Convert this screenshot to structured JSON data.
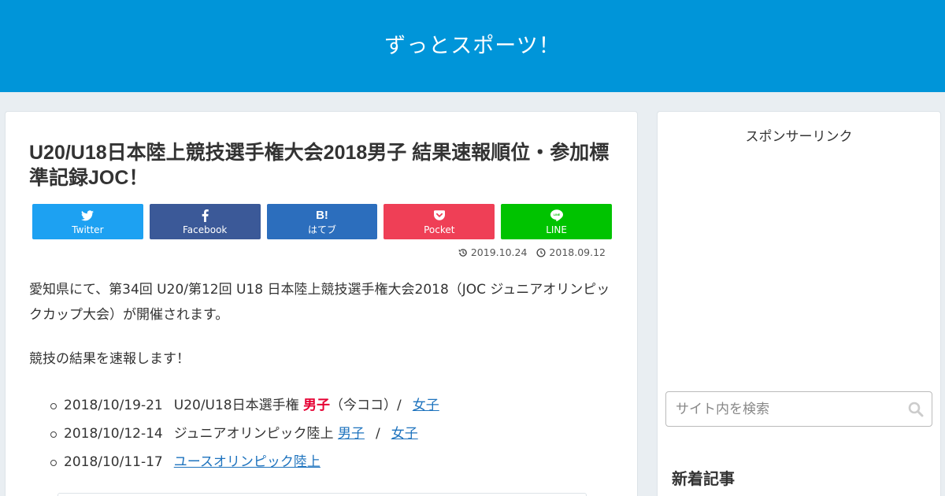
{
  "site": {
    "title": "ずっとスポーツ！"
  },
  "article": {
    "title": "U20/U18日本陸上競技選手権大会2018男子 結果速報順位・参加標準記録JOC！",
    "updated_date": "2019.10.24",
    "published_date": "2018.09.12",
    "paragraph1": "愛知県にて、第34回 U20/第12回 U18 日本陸上競技選手権大会2018（JOC ジュニアオリンピックカップ大会）が開催されます。",
    "paragraph2": "競技の結果を速報します！",
    "schedule": [
      {
        "dates": "2018/10/19-21",
        "event": "U20/U18日本選手権",
        "current": "男子",
        "current_note": "（今ココ）/",
        "link1": "女子"
      },
      {
        "dates": "2018/10/12-14",
        "event": "ジュニアオリンピック陸上",
        "link1": "男子",
        "sep": "/",
        "link2": "女子"
      },
      {
        "dates": "2018/10/11-17",
        "link1": "ユースオリンピック陸上"
      }
    ]
  },
  "share": {
    "twitter": "Twitter",
    "facebook": "Facebook",
    "hatebu": "はてブ",
    "hatebu_icon": "B!",
    "pocket": "Pocket",
    "line": "LINE"
  },
  "sidebar": {
    "sponsor_label": "スポンサーリンク",
    "search_placeholder": "サイト内を検索",
    "recent_title": "新着記事"
  },
  "colors": {
    "header": "#0095d9",
    "twitter": "#1da1f2",
    "facebook": "#3b5998",
    "hatebu": "#2c6ebd",
    "pocket": "#ef3f56",
    "line": "#00c300",
    "link": "#1e73be",
    "highlight": "#e60033"
  }
}
